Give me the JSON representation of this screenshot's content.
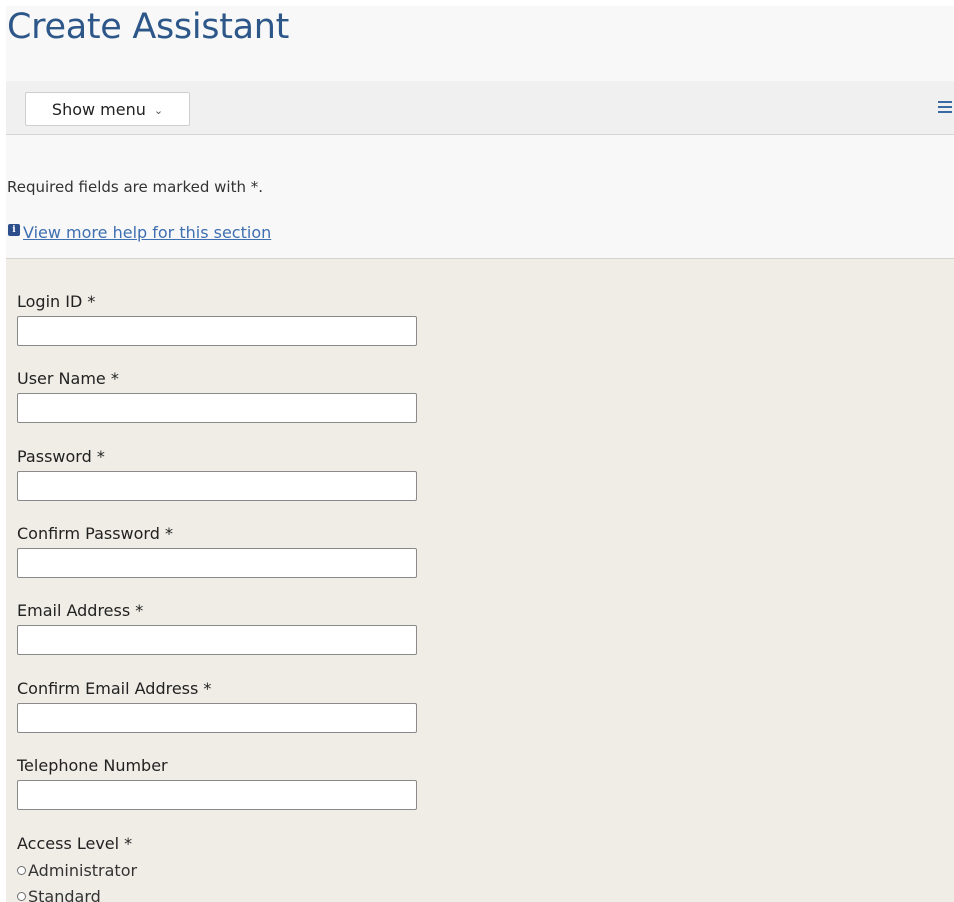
{
  "page": {
    "title": "Create Assistant"
  },
  "menu_bar": {
    "show_menu_label": "Show menu",
    "chevron": "chevron-down-icon",
    "hamburger": "hamburger-menu-icon"
  },
  "intro": {
    "required_note": "Required fields are marked with  *.",
    "help_icon": "info-icon",
    "help_link": "View more help for this section"
  },
  "form": {
    "fields": [
      {
        "label": "Login ID *",
        "value": ""
      },
      {
        "label": "User Name *",
        "value": ""
      },
      {
        "label": "Password *",
        "value": ""
      },
      {
        "label": "Confirm Password *",
        "value": ""
      },
      {
        "label": "Email Address *",
        "value": ""
      },
      {
        "label": "Confirm Email Address *",
        "value": ""
      },
      {
        "label": "Telephone Number",
        "value": ""
      }
    ],
    "access_level": {
      "label": "Access Level *",
      "options": [
        "Administrator",
        "Standard"
      ],
      "selected": ""
    }
  },
  "colors": {
    "title": "#2d5789",
    "link": "#3e6fb0",
    "form_background": "#efede6",
    "page_background": "#f8f8f8",
    "menu_bar_background": "#f0f0f0"
  }
}
